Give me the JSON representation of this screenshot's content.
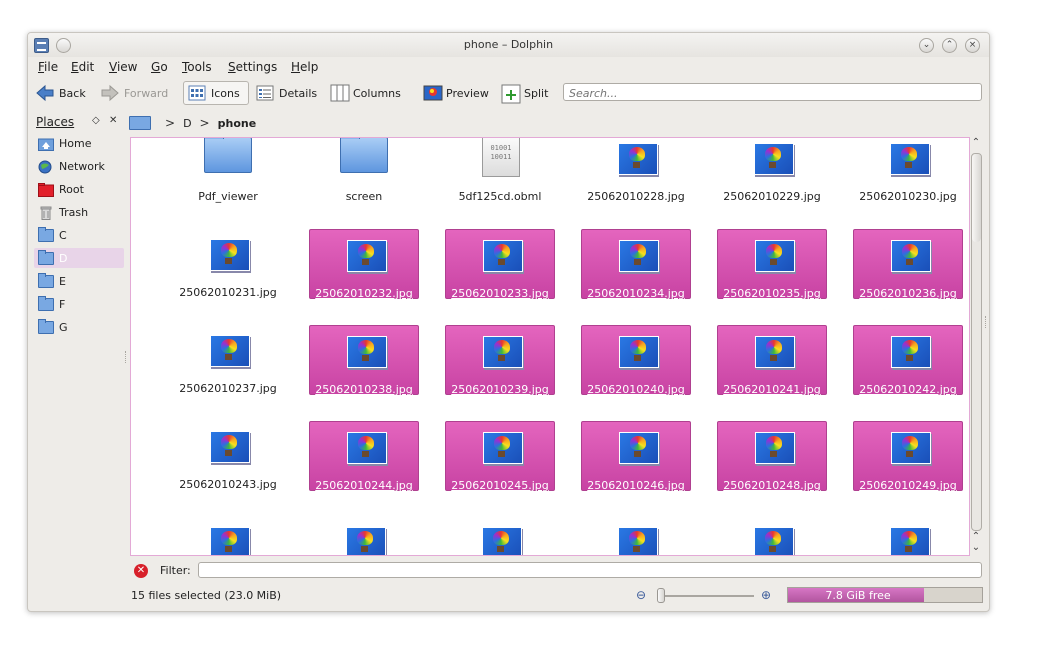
{
  "window": {
    "title": "phone – Dolphin"
  },
  "menu": [
    "File",
    "Edit",
    "View",
    "Go",
    "Tools",
    "Settings",
    "Help"
  ],
  "toolbar": {
    "back": "Back",
    "forward": "Forward",
    "icons": "Icons",
    "details": "Details",
    "columns": "Columns",
    "preview": "Preview",
    "split": "Split",
    "search_placeholder": "Search..."
  },
  "places": {
    "header": "Places",
    "items": [
      {
        "label": "Home",
        "icon": "home-icon"
      },
      {
        "label": "Network",
        "icon": "network-icon"
      },
      {
        "label": "Root",
        "icon": "root-folder-icon"
      },
      {
        "label": "Trash",
        "icon": "trash-icon"
      },
      {
        "label": "C",
        "icon": "drive-icon"
      },
      {
        "label": "D",
        "icon": "drive-icon",
        "selected": true
      },
      {
        "label": "E",
        "icon": "drive-icon"
      },
      {
        "label": "F",
        "icon": "drive-icon"
      },
      {
        "label": "G",
        "icon": "drive-icon"
      }
    ]
  },
  "breadcrumb": {
    "segments": [
      "D"
    ],
    "current": "phone"
  },
  "files": [
    {
      "name": "Pdf_viewer",
      "type": "folder",
      "selected": false
    },
    {
      "name": "screen",
      "type": "folder",
      "selected": false
    },
    {
      "name": "5df125cd.obml",
      "type": "binary",
      "selected": false
    },
    {
      "name": "25062010228.jpg",
      "type": "image",
      "selected": false
    },
    {
      "name": "25062010229.jpg",
      "type": "image",
      "selected": false
    },
    {
      "name": "25062010230.jpg",
      "type": "image",
      "selected": false
    },
    {
      "name": "25062010231.jpg",
      "type": "image",
      "selected": false
    },
    {
      "name": "25062010232.jpg",
      "type": "image",
      "selected": true
    },
    {
      "name": "25062010233.jpg",
      "type": "image",
      "selected": true
    },
    {
      "name": "25062010234.jpg",
      "type": "image",
      "selected": true
    },
    {
      "name": "25062010235.jpg",
      "type": "image",
      "selected": true
    },
    {
      "name": "25062010236.jpg",
      "type": "image",
      "selected": true
    },
    {
      "name": "25062010237.jpg",
      "type": "image",
      "selected": false
    },
    {
      "name": "25062010238.jpg",
      "type": "image",
      "selected": true
    },
    {
      "name": "25062010239.jpg",
      "type": "image",
      "selected": true
    },
    {
      "name": "25062010240.jpg",
      "type": "image",
      "selected": true
    },
    {
      "name": "25062010241.jpg",
      "type": "image",
      "selected": true
    },
    {
      "name": "25062010242.jpg",
      "type": "image",
      "selected": true
    },
    {
      "name": "25062010243.jpg",
      "type": "image",
      "selected": false
    },
    {
      "name": "25062010244.jpg",
      "type": "image",
      "selected": true
    },
    {
      "name": "25062010245.jpg",
      "type": "image",
      "selected": true
    },
    {
      "name": "25062010246.jpg",
      "type": "image",
      "selected": true
    },
    {
      "name": "25062010248.jpg",
      "type": "image",
      "selected": true
    },
    {
      "name": "25062010249.jpg",
      "type": "image",
      "selected": true
    },
    {
      "name": "",
      "type": "image",
      "selected": false
    },
    {
      "name": "",
      "type": "image",
      "selected": false
    },
    {
      "name": "",
      "type": "image",
      "selected": false
    },
    {
      "name": "",
      "type": "image",
      "selected": false
    },
    {
      "name": "",
      "type": "image",
      "selected": false
    },
    {
      "name": "",
      "type": "image",
      "selected": false
    }
  ],
  "filter": {
    "label": "Filter:",
    "value": ""
  },
  "status": {
    "text": "15 files selected (23.0 MiB)",
    "free_space": "7.8 GiB free",
    "used_fraction": 0.7
  },
  "colors": {
    "selection": "#d655b5",
    "accent": "#3e6fb0"
  }
}
